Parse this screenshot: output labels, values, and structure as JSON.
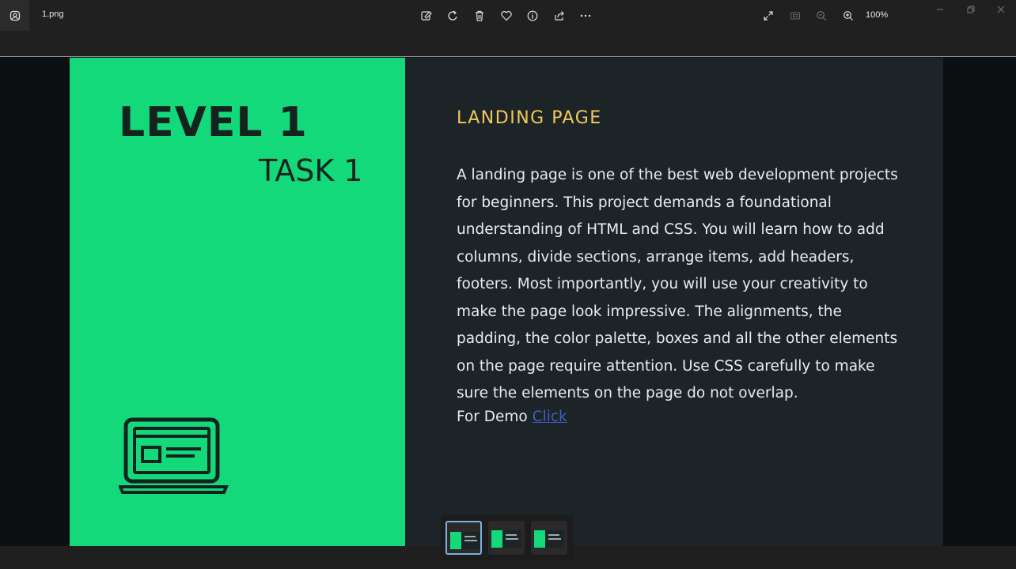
{
  "titlebar": {
    "filename": "1.png",
    "zoom_level": "100%",
    "icons": [
      "photos-app-icon",
      "edit-image-icon",
      "rotate-icon",
      "delete-icon",
      "favorite-icon",
      "info-icon",
      "share-icon",
      "more-icon",
      "fullscreen-icon",
      "fit-icon",
      "zoom-out-icon",
      "zoom-in-icon"
    ],
    "window_buttons": [
      "minimize",
      "restore",
      "close"
    ]
  },
  "slide": {
    "left_panel": {
      "title": "LEVEL 1",
      "subtitle": "TASK 1",
      "icon": "laptop-icon",
      "color": "#13d97b"
    },
    "heading": "LANDING PAGE",
    "body": "A landing page is one of the best web development projects for beginners. This project demands a foundational understanding of HTML and CSS. You will learn how to add columns, divide sections, arrange items, add headers, footers. Most importantly, you will use your creativity to make the page look impressive. The alignments, the padding, the color palette, boxes and all the other elements on the page require attention. Use CSS carefully to make sure the elements on the page do not overlap.",
    "demo_prefix": "For Demo",
    "demo_link": "Click "
  },
  "filmstrip": {
    "count": 3,
    "selected_index": 0
  },
  "colors": {
    "accent_green": "#13d97b",
    "heading_yellow": "#f2c95a",
    "dark_bg": "#1d2428",
    "link_blue": "#3d5fc8"
  }
}
